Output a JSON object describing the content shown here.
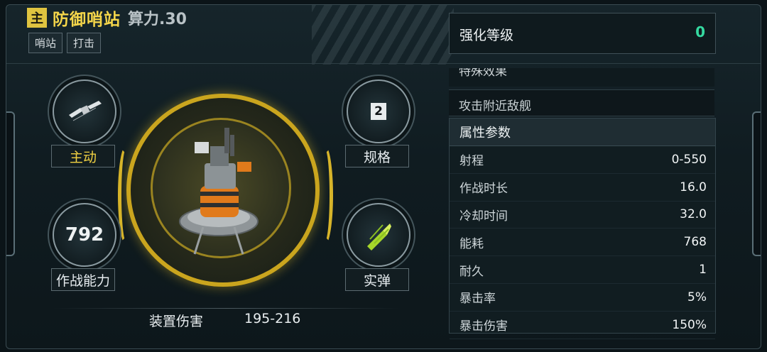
{
  "header": {
    "badge": "主",
    "title": "防御哨站",
    "power": "算力.30",
    "tags": [
      "哨站",
      "打击"
    ]
  },
  "nodes": {
    "active_label": "主动",
    "spec_value": "2",
    "spec_label": "规格",
    "combat_value": "792",
    "combat_label": "作战能力",
    "ammo_label": "实弹"
  },
  "damage": {
    "label": "装置伤害",
    "value": "195-216"
  },
  "enhance": {
    "label": "强化等级",
    "value": "0"
  },
  "special": {
    "header": "特殊效果",
    "desc": "攻击附近敌舰"
  },
  "attributes": {
    "title": "属性参数",
    "rows": [
      {
        "name": "射程",
        "value": "0-550"
      },
      {
        "name": "作战时长",
        "value": "16.0"
      },
      {
        "name": "冷却时间",
        "value": "32.0"
      },
      {
        "name": "能耗",
        "value": "768"
      },
      {
        "name": "耐久",
        "value": "1"
      },
      {
        "name": "暴击率",
        "value": "5%"
      },
      {
        "name": "暴击伤害",
        "value": "150%"
      }
    ]
  },
  "colors": {
    "accent_gold": "#f1d142",
    "enhance_green": "#35d9a0"
  },
  "icons": {
    "active_node": "satellite-icon",
    "ammo_node": "missile-icon",
    "center": "turret-icon"
  }
}
